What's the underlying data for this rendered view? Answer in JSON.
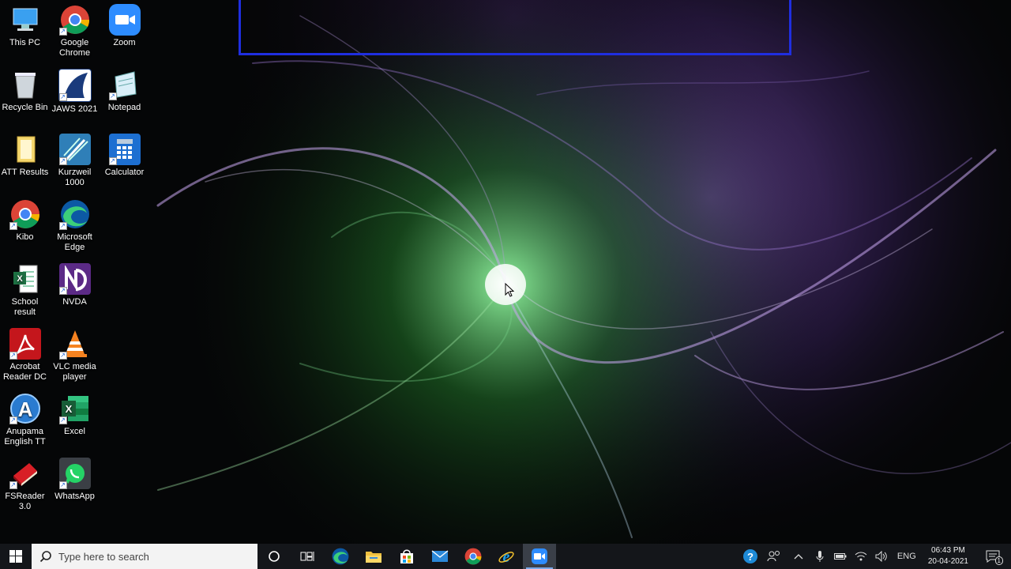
{
  "desktop": {
    "icons": [
      {
        "label": "This PC",
        "icon": "this-pc-icon"
      },
      {
        "label": "Google Chrome",
        "icon": "chrome-icon"
      },
      {
        "label": "Zoom",
        "icon": "zoom-icon"
      },
      {
        "label": "Recycle Bin",
        "icon": "recycle-bin-icon"
      },
      {
        "label": "JAWS 2021",
        "icon": "jaws-icon"
      },
      {
        "label": "Notepad",
        "icon": "notepad-icon"
      },
      {
        "label": "ATT Results",
        "icon": "folder-icon"
      },
      {
        "label": "Kurzweil 1000",
        "icon": "kurzweil-icon"
      },
      {
        "label": "Calculator",
        "icon": "calculator-icon"
      },
      {
        "label": "Kibo",
        "icon": "chrome-icon"
      },
      {
        "label": "Microsoft Edge",
        "icon": "edge-icon"
      },
      {
        "label": "School result",
        "icon": "excel-file-icon"
      },
      {
        "label": "NVDA",
        "icon": "nvda-icon"
      },
      {
        "label": "Acrobat Reader DC",
        "icon": "acrobat-icon"
      },
      {
        "label": "VLC media player",
        "icon": "vlc-icon"
      },
      {
        "label": "Anupama English TT",
        "icon": "anupama-icon"
      },
      {
        "label": "Excel",
        "icon": "excel-icon"
      },
      {
        "label": "FSReader 3.0",
        "icon": "fsreader-icon"
      },
      {
        "label": "WhatsApp",
        "icon": "whatsapp-icon"
      }
    ]
  },
  "taskbar": {
    "search_placeholder": "Type here to search",
    "pinned": [
      "cortana-icon",
      "task-view-icon",
      "edge-icon",
      "file-explorer-icon",
      "store-icon",
      "mail-icon",
      "chrome-icon",
      "internet-explorer-icon",
      "zoom-icon"
    ],
    "active_app": "zoom-icon",
    "tray": {
      "language": "ENG",
      "time": "06:43 PM",
      "date": "20-04-2021",
      "notification_count": "1"
    }
  },
  "colors": {
    "focus_rect": "#1f2ee0",
    "taskbar_bg": "#14161a"
  }
}
